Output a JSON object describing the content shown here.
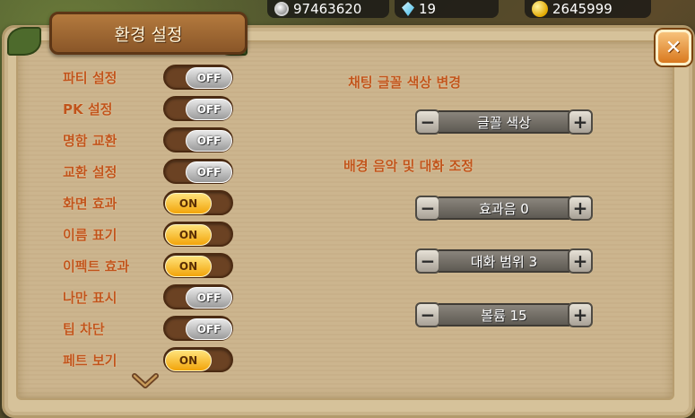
{
  "resources": {
    "coins": "97463620",
    "gems": "19",
    "gold": "2645999"
  },
  "window": {
    "title": "환경 설정",
    "close_label": "✕"
  },
  "toggles": [
    {
      "label": "파티 설정",
      "state": "OFF"
    },
    {
      "label": "PK 설정",
      "state": "OFF"
    },
    {
      "label": "명함 교환",
      "state": "OFF"
    },
    {
      "label": "교환 설정",
      "state": "OFF"
    },
    {
      "label": "화면 효과",
      "state": "ON"
    },
    {
      "label": "이름 표기",
      "state": "ON"
    },
    {
      "label": "이펙트 효과",
      "state": "ON"
    },
    {
      "label": "나만 표시",
      "state": "OFF"
    },
    {
      "label": "팁 차단",
      "state": "OFF"
    },
    {
      "label": "페트 보기",
      "state": "ON"
    }
  ],
  "chat_font": {
    "section_title": "채팅 글꼴 색상 변경",
    "value": "글꼴 색상"
  },
  "audio": {
    "section_title": "배경 음악 및 대화 조정",
    "effect_sound": "효과음 0",
    "chat_range": "대화 범위 3",
    "volume": "볼륨 15"
  },
  "stepper_labels": {
    "minus": "−",
    "plus": "+"
  },
  "colors": {
    "label_orange": "#c0541b",
    "toggle_on": "#f2a40a",
    "toggle_off": "#9b9b9b",
    "panel_bg": "#ccb58e"
  }
}
